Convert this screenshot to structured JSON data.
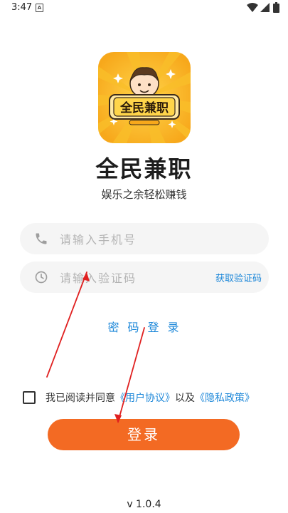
{
  "status_bar": {
    "time": "3:47",
    "notification_badge": "A"
  },
  "app": {
    "name": "全民兼职",
    "slogan": "娱乐之余轻松赚钱",
    "logo_text": "全民兼职"
  },
  "form": {
    "phone_placeholder": "请输入手机号",
    "code_placeholder": "请输入验证码",
    "get_code_label": "获取验证码",
    "password_login_label": "密码登录"
  },
  "agreement": {
    "prefix": "我已阅读并同意",
    "user_agreement": "《用户协议》",
    "connector": "以及",
    "privacy_policy": "《隐私政策》",
    "checked": false
  },
  "login_button": {
    "label": "登录"
  },
  "version": "v 1.0.4",
  "colors": {
    "accent": "#f36a23",
    "link": "#1e88d9",
    "input_bg": "#f5f5f5",
    "annotation": "#e02020"
  }
}
